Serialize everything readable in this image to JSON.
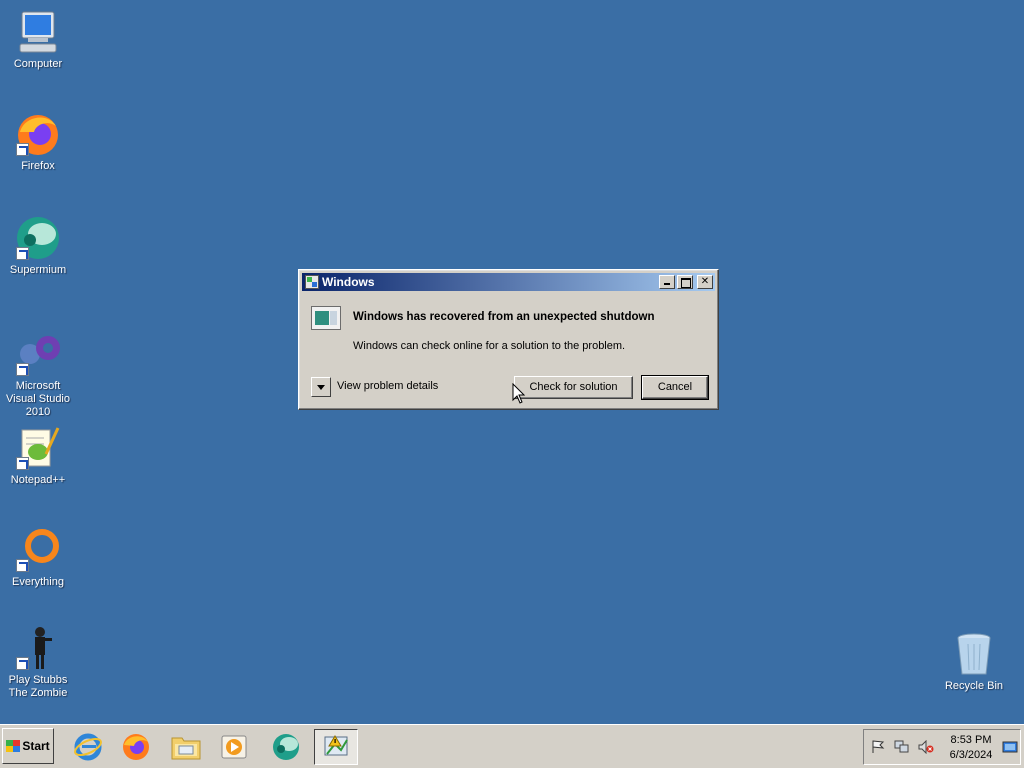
{
  "desktop": {
    "icons": [
      {
        "label": "Computer",
        "icon": "computer-icon"
      },
      {
        "label": "Firefox",
        "icon": "firefox-icon"
      },
      {
        "label": "Supermium",
        "icon": "supermium-icon"
      },
      {
        "label": "Microsoft Visual Studio 2010",
        "icon": "visual-studio-icon"
      },
      {
        "label": "Notepad++",
        "icon": "notepad-plus-plus-icon"
      },
      {
        "label": "Everything",
        "icon": "everything-icon"
      },
      {
        "label": "Play Stubbs The Zombie",
        "icon": "stubbs-zombie-icon"
      },
      {
        "label": "Recycle Bin",
        "icon": "recycle-bin-icon"
      }
    ]
  },
  "dialog": {
    "title": "Windows",
    "heading": "Windows has recovered from an unexpected shutdown",
    "body": "Windows can check online for a solution to the problem.",
    "details_label": "View problem details",
    "check_button": "Check for solution",
    "cancel_button": "Cancel",
    "close_glyph": "✕"
  },
  "taskbar": {
    "start_label": "Start",
    "pinned": [
      "internet-explorer-icon",
      "firefox-icon",
      "file-explorer-icon",
      "media-player-icon",
      "supermium-icon",
      "problem-reports-icon"
    ],
    "clock_time": "8:53 PM",
    "clock_date": "6/3/2024"
  },
  "colors": {
    "desktop_bg": "#3a6ea5",
    "title_gradient_start": "#0a246a",
    "title_gradient_end": "#a6caf0",
    "chrome": "#d4d0c8"
  }
}
